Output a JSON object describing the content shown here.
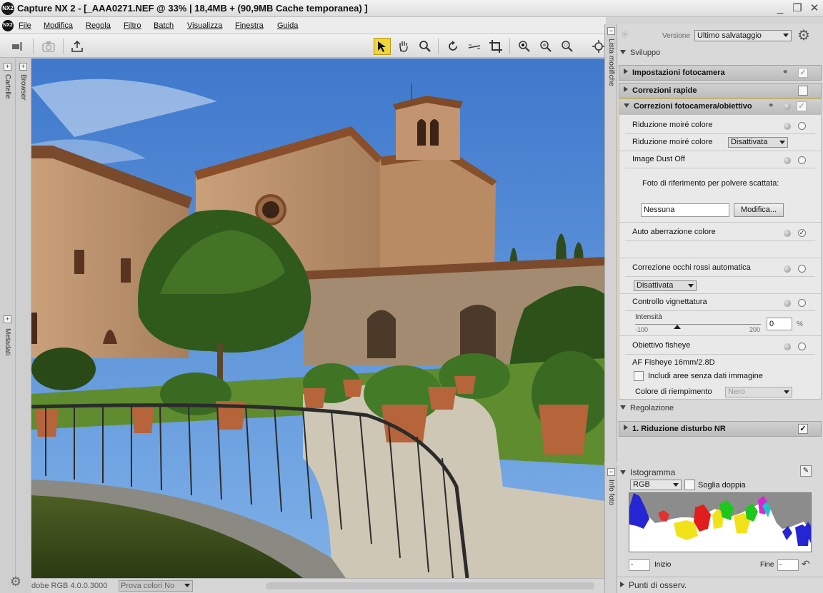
{
  "window": {
    "logo": "NX2",
    "title": "Capture NX 2 - [_AAA0271.NEF @ 33% | 18,4MB + (90,9MB Cache temporanea) ]",
    "controls": [
      "_",
      "❐",
      "✕"
    ]
  },
  "menu": {
    "logo": "NX2",
    "items": [
      "File",
      "Modifica",
      "Regola",
      "Filtro",
      "Batch",
      "Visualizza",
      "Finestra",
      "Guida"
    ]
  },
  "toolbar": {
    "tools": [
      "select-arrow-icon",
      "hand-icon",
      "zoom-icon",
      "rotate-icon",
      "straighten-icon",
      "crop-icon",
      "black-point-icon",
      "neutral-point-icon",
      "white-point-icon"
    ]
  },
  "left_sidebar": {
    "tabs": [
      "Cartelle",
      "Browser",
      "Metadati"
    ]
  },
  "status": {
    "profile": "dobe RGB 4.0.0.3000",
    "softproof": "Prova colori No"
  },
  "right_tabs": [
    "Lista modifiche",
    "Info foto"
  ],
  "edit_list": {
    "version_label": "Versione",
    "version_value": "Ultimo salvataggio",
    "sviluppo_title": "Sviluppo",
    "camera_settings": "Impostazioni fotocamera",
    "quick_fix": "Correzioni rapide",
    "camera_lens": {
      "title": "Correzioni fotocamera/obiettivo",
      "moire_title": "Riduzione moiré colore",
      "moire_label": "Riduzione moiré colore",
      "moire_value": "Disattivata",
      "dust_title": "Image Dust Off",
      "dust_ref_label": "Foto di riferimento per polvere scattata:",
      "dust_ref_value": "Nessuna",
      "dust_button": "Modifica...",
      "auto_ca": "Auto aberrazione colore",
      "red_eye": "Correzione occhi rossi automatica",
      "red_eye_value": "Disattivata",
      "vignette": "Controllo vignettatura",
      "intensity_label": "Intensità",
      "intensity_min": "-100",
      "intensity_max": "200",
      "intensity_value": "0",
      "intensity_unit": "%",
      "fisheye": "Obiettivo fisheye",
      "fisheye_lens": "AF Fisheye 16mm/2.8D",
      "include_areas": "Includi aree senza dati immagine",
      "fill_color_label": "Colore di riempimento",
      "fill_color_value": "Nero"
    },
    "regolazione_title": "Regolazione",
    "nr_step": "1. Riduzione disturbo NR"
  },
  "histogram": {
    "title": "Istogramma",
    "channel": "RGB",
    "dual_threshold": "Soglia doppia",
    "start_label": "Inizio",
    "start_value": "-",
    "end_label": "Fine",
    "end_value": "-"
  },
  "watch_points": "Punti di osserv."
}
